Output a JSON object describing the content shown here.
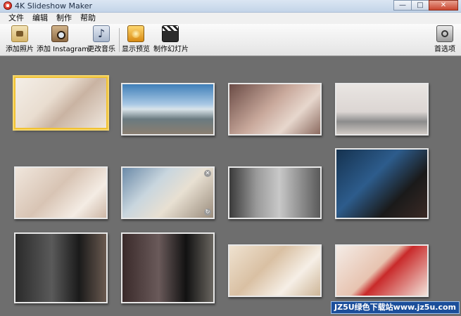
{
  "window": {
    "title": "4K Slideshow Maker"
  },
  "menu": [
    "文件",
    "编辑",
    "制作",
    "帮助"
  ],
  "toolbar": {
    "add_photo": "添加照片",
    "add_instagram": "添加 Instagram",
    "change_music": "更改音乐",
    "show_preview": "显示预览",
    "make_slideshow": "制作幻灯片",
    "preferences": "首选项"
  },
  "icons": {
    "app": "app-icon",
    "add_photo": "photo-icon",
    "add_instagram": "instagram-camera-icon",
    "change_music": "music-note-icon",
    "show_preview": "preview-icon",
    "make_slideshow": "clapperboard-icon",
    "preferences": "preferences-icon"
  },
  "colors": {
    "selection_border": "#f1c232",
    "content_bg": "#6e6e6e"
  },
  "thumbnails": [
    {
      "id": 1,
      "selected": true,
      "bg": "linear-gradient(135deg,#f4efe8 0%,#e9ddd0 40%,#c9b3a2 60%,#efe7de 100%)"
    },
    {
      "id": 2,
      "selected": false,
      "bg": "linear-gradient(#3f7fb8 0%,#a8c8e4 40%,#d9e4ea 50%,#6a7a80 70%,#8a7e70 100%)"
    },
    {
      "id": 3,
      "selected": false,
      "bg": "linear-gradient(135deg,#6b4c46 0%,#c9a99c 45%,#e7d7cd 70%,#8b6a5f 100%)"
    },
    {
      "id": 4,
      "selected": false,
      "bg": "linear-gradient(#e9e5e2 0%,#dcd6d3 55%,#8c8c8c 75%,#cfc9c4 100%)"
    },
    {
      "id": 5,
      "selected": false,
      "bg": "linear-gradient(135deg,#f0e6dc 0%,#d8c4b4 45%,#f4ece4 75%,#cdb7a6 100%)"
    },
    {
      "id": 6,
      "selected": false,
      "bg": "linear-gradient(135deg,#6b8aa8 0%,#c9d6de 35%,#e8e0d2 60%,#9a8c7c 100%)"
    },
    {
      "id": 7,
      "selected": false,
      "bg": "linear-gradient(90deg,#3a3a3a 0%,#9a9a9a 30%,#c8c8c8 55%,#5a5a5a 100%)"
    },
    {
      "id": 8,
      "selected": false,
      "bg": "linear-gradient(135deg,#15324f 0%,#2d5c8c 40%,#1a1a1a 70%,#3b2a25 100%)"
    },
    {
      "id": 9,
      "selected": false,
      "bg": "linear-gradient(90deg,#2a2a2a 0%,#5a5a5a 40%,#1a1a1a 70%,#6a5a50 100%)"
    },
    {
      "id": 10,
      "selected": false,
      "bg": "linear-gradient(90deg,#3a2a2a 0%,#6a5a5a 40%,#111 70%,#6a6660 100%)"
    },
    {
      "id": 11,
      "selected": false,
      "bg": "linear-gradient(135deg,#efe2d0 0%,#d9c0a3 40%,#f6efe6 70%,#cdb597 100%)"
    },
    {
      "id": 12,
      "selected": false,
      "bg": "linear-gradient(135deg,#f4ece6 0%,#e7c3b0 45%,#c92a2a 55%,#f2e3da 100%)"
    }
  ],
  "watermark": "JZ5U绿色下载站www.jz5u.com"
}
